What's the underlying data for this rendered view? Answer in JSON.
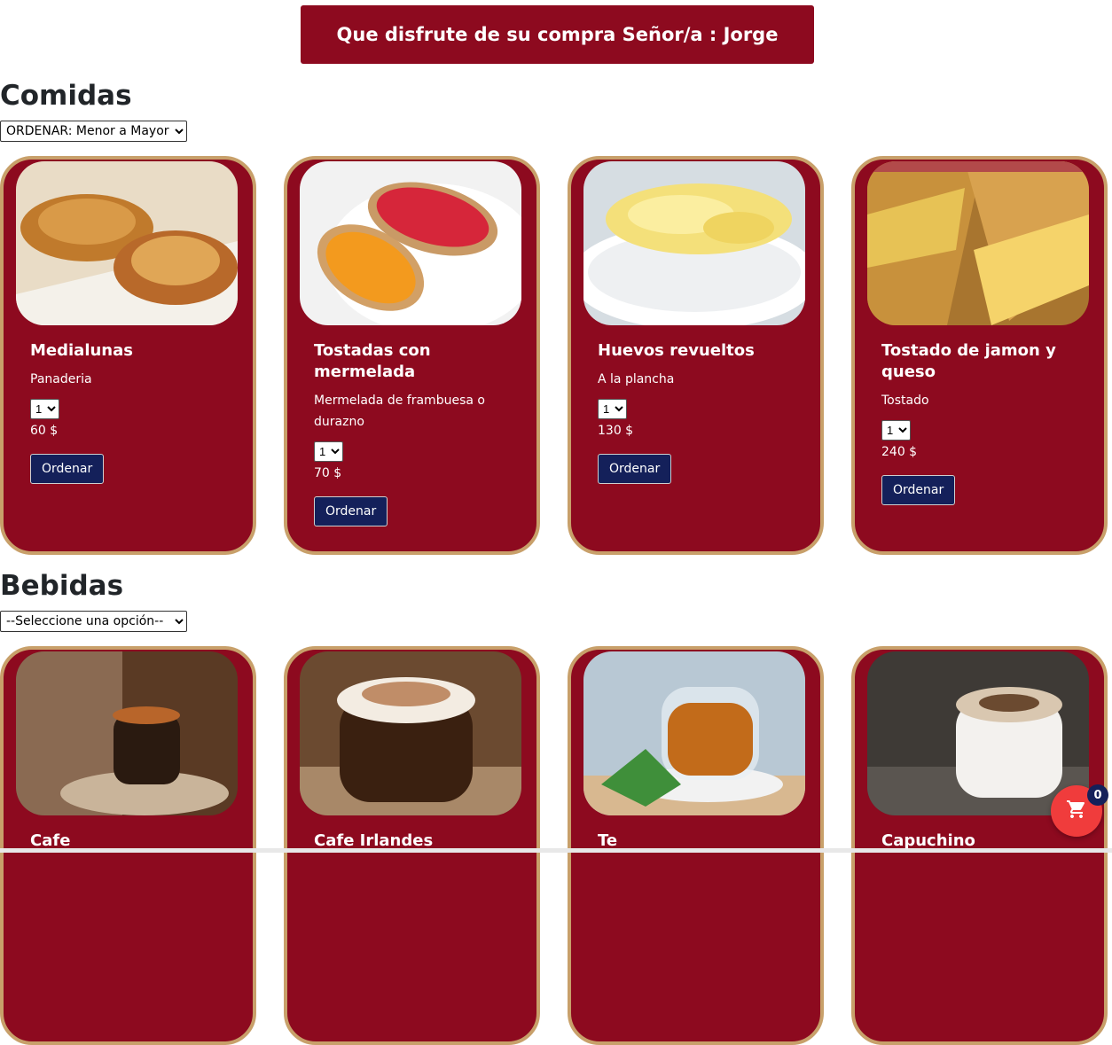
{
  "header": {
    "welcome": "Que disfrute de su compra Señor/a : Jorge"
  },
  "comidas": {
    "title": "Comidas",
    "sort_value": "ORDENAR: Menor a Mayor",
    "items": [
      {
        "name": "Medialunas",
        "desc": "Panaderia",
        "qty": "1",
        "price": "60 $",
        "button": "Ordenar"
      },
      {
        "name": "Tostadas con mermelada",
        "desc": "Mermelada de frambuesa o durazno",
        "qty": "1",
        "price": "70 $",
        "button": "Ordenar"
      },
      {
        "name": "Huevos revueltos",
        "desc": "A la plancha",
        "qty": "1",
        "price": "130 $",
        "button": "Ordenar"
      },
      {
        "name": "Tostado de jamon y queso",
        "desc": "Tostado",
        "qty": "1",
        "price": "240 $",
        "button": "Ordenar"
      }
    ]
  },
  "bebidas": {
    "title": "Bebidas",
    "sort_value": "--Seleccione una opción--",
    "items": [
      {
        "name": "Cafe"
      },
      {
        "name": "Cafe Irlandes"
      },
      {
        "name": "Te"
      },
      {
        "name": "Capuchino"
      }
    ]
  },
  "cart": {
    "count": "0",
    "icon": "cart-icon"
  },
  "colors": {
    "card_bg": "#8d0a1f",
    "card_border": "#c8a06a",
    "button_bg": "#14205a",
    "cart_bg": "#f03c3c"
  }
}
